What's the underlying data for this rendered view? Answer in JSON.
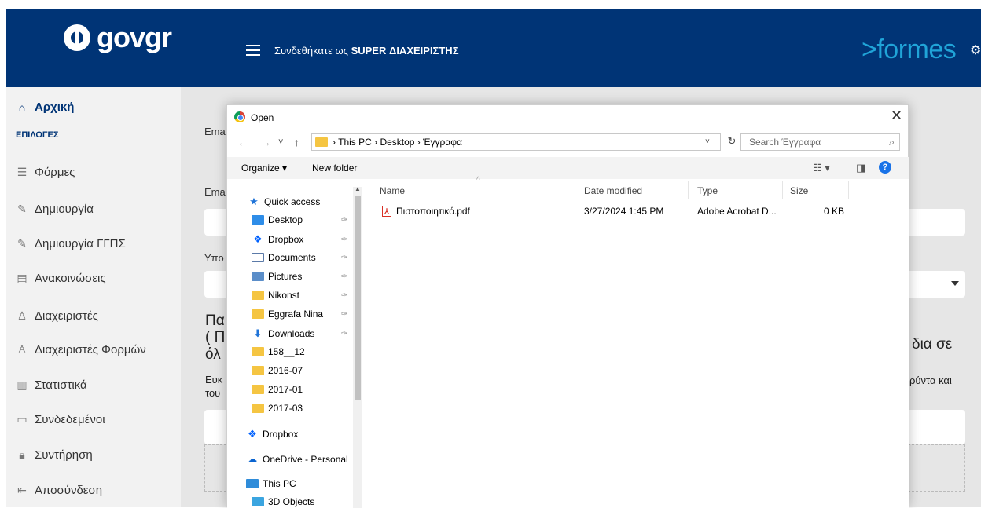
{
  "header": {
    "logo_text_gov": "gov",
    "logo_text_gr": "gr",
    "logged_prefix": "Συνδεθήκατε ως ",
    "logged_role": "SUPER ΔΙΑΧΕΙΡΙΣΤΗΣ",
    "brand_arrow": ">",
    "brand_name": "formes",
    "gear_glyph": "⚙"
  },
  "sidebar": {
    "home": "Αρχική",
    "section": "ΕΠΙΛΟΓΕΣ",
    "items": [
      {
        "label": "Φόρμες",
        "icon": "list-icon"
      },
      {
        "label": "Δημιουργία",
        "icon": "pencil-icon"
      },
      {
        "label": "Δημιουργία ΓΓΠΣ",
        "icon": "pencil-icon"
      },
      {
        "label": "Ανακοινώσεις",
        "icon": "newspaper-icon"
      },
      {
        "label": "Διαχειριστές",
        "icon": "user-icon"
      },
      {
        "label": "Διαχειριστές Φορμών",
        "icon": "users-icon"
      },
      {
        "label": "Στατιστικά",
        "icon": "chart-icon"
      },
      {
        "label": "Συνδεδεμένοι",
        "icon": "monitor-icon"
      },
      {
        "label": "Συντήρηση",
        "icon": "lock-icon"
      },
      {
        "label": "Αποσύνδεση",
        "icon": "logout-icon"
      }
    ]
  },
  "main": {
    "label1": "Ema",
    "label2": "Ema",
    "label3": "Υπο",
    "big1": "Πα",
    "big2": "( Π",
    "big3": "όλ",
    "small1": "Ευκ",
    "small2": "του",
    "big_right": "δια σε",
    "small_right": "ρύντα και"
  },
  "dialog": {
    "title": "Open",
    "close": "✕",
    "nav_back": "←",
    "nav_forward": "→",
    "nav_recent": "˅",
    "nav_up": "↑",
    "breadcrumb": "›  This PC  ›  Desktop  ›  Έγγραφα",
    "addr_dropdown": "˅",
    "refresh": "↻",
    "search_placeholder": "Search Έγγραφα",
    "search_glyph": "⌕",
    "organize": "Organize ▾",
    "new_folder": "New folder",
    "view_glyph": "☷ ▾",
    "pane_glyph": "◨",
    "help_glyph": "?",
    "nav_items": [
      {
        "label": "Quick access",
        "kind": "star",
        "pinned": false
      },
      {
        "label": "Desktop",
        "kind": "desk",
        "pinned": true
      },
      {
        "label": "Dropbox",
        "kind": "drop",
        "pinned": true
      },
      {
        "label": "Documents",
        "kind": "doc",
        "pinned": true
      },
      {
        "label": "Pictures",
        "kind": "pic",
        "pinned": true
      },
      {
        "label": "Nikonst",
        "kind": "fold",
        "pinned": true
      },
      {
        "label": "Eggrafa Nina",
        "kind": "fold",
        "pinned": true
      },
      {
        "label": "Downloads",
        "kind": "down",
        "pinned": true
      },
      {
        "label": "158__12",
        "kind": "fold",
        "pinned": false
      },
      {
        "label": "2016-07",
        "kind": "fold",
        "pinned": false
      },
      {
        "label": "2017-01",
        "kind": "fold",
        "pinned": false
      },
      {
        "label": "2017-03",
        "kind": "fold",
        "pinned": false
      },
      {
        "label": "Dropbox",
        "kind": "drop",
        "pinned": false
      },
      {
        "label": "OneDrive - Personal",
        "kind": "cloud",
        "pinned": false
      },
      {
        "label": "This PC",
        "kind": "pc",
        "pinned": false
      },
      {
        "label": "3D Objects",
        "kind": "3d",
        "pinned": false
      }
    ],
    "pin_glyph": "✑",
    "columns": {
      "name": "Name",
      "date": "Date modified",
      "type": "Type",
      "size": "Size"
    },
    "files": [
      {
        "name": "Πιστοποιητικό.pdf",
        "date": "3/27/2024 1:45 PM",
        "type": "Adobe Acrobat D...",
        "size": "0 KB"
      }
    ]
  }
}
